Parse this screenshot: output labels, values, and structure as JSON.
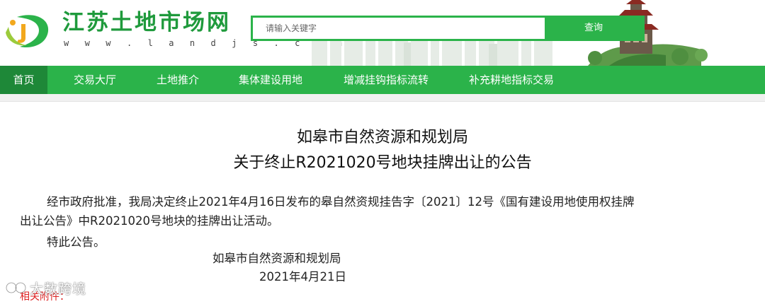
{
  "site": {
    "name": "江苏土地市场网",
    "url_text": "w w w . l a n d j s . c o m"
  },
  "search": {
    "placeholder": "请输入关键字",
    "button_label": "查询"
  },
  "nav": {
    "items": [
      {
        "label": "首页",
        "active": true
      },
      {
        "label": "交易大厅",
        "active": false
      },
      {
        "label": "土地推介",
        "active": false
      },
      {
        "label": "集体建设用地",
        "active": false
      },
      {
        "label": "增减挂钩指标流转",
        "active": false
      },
      {
        "label": "补充耕地指标交易",
        "active": false
      }
    ]
  },
  "article": {
    "title_line1": "如皋市自然资源和规划局",
    "title_line2": "关于终止R2021020号地块挂牌出让的公告",
    "body": "经市政府批准，我局决定终止2021年4月16日发布的皋自然资规挂告字〔2021〕12号《国有建设用地使用权挂牌出让公告》中R2021020号地块的挂牌出让活动。",
    "closing": "特此公告。",
    "signature_org": "如皋市自然资源和规划局",
    "signature_date": "2021年4月21日",
    "attachments_label": "相关附件："
  },
  "watermark": {
    "text": "大数跨境"
  },
  "colors": {
    "brand_green": "#2bb34a",
    "nav_active": "#1e8838",
    "title_green": "#1f9a3c",
    "attachment_red": "#d22222"
  },
  "icons": {
    "logo": "site-logo-icon",
    "watermark": "watermark-logo-icon"
  }
}
